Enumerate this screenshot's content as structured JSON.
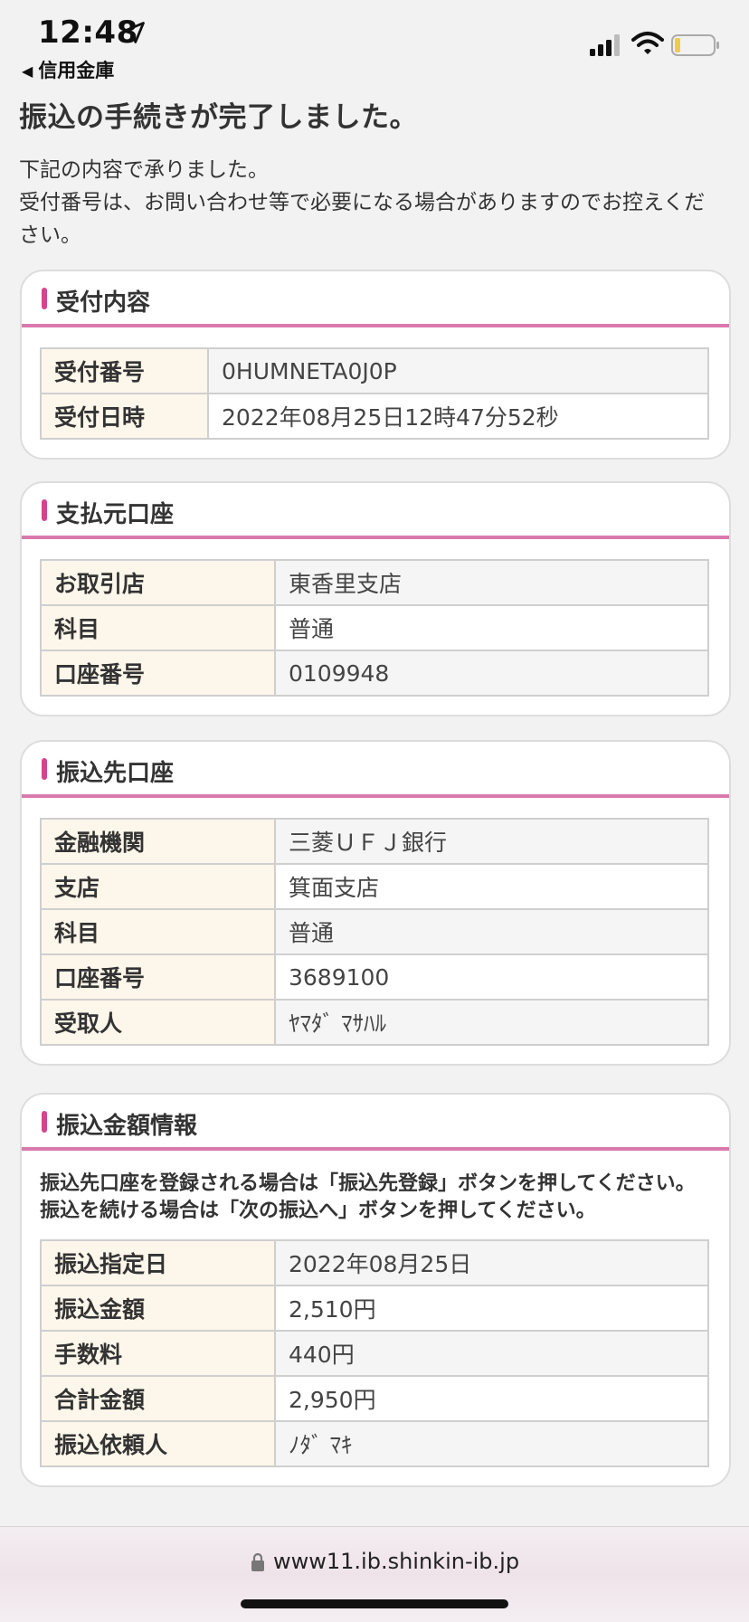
{
  "status_bar": {
    "time": "12:48",
    "back_label": "信用金庫"
  },
  "page": {
    "heading": "振込の手続きが完了しました。",
    "intro": "下記の内容で承りました。\n受付番号は、お問い合わせ等で必要になる場合がありますのでお控えください。"
  },
  "reception": {
    "title": "受付内容",
    "rows": [
      {
        "label": "受付番号",
        "value": "0HUMNETA0J0P"
      },
      {
        "label": "受付日時",
        "value": "2022年08月25日12時47分52秒"
      }
    ]
  },
  "source_account": {
    "title": "支払元口座",
    "rows": [
      {
        "label": "お取引店",
        "value": "東香里支店"
      },
      {
        "label": "科目",
        "value": "普通"
      },
      {
        "label": "口座番号",
        "value": "0109948"
      }
    ]
  },
  "destination_account": {
    "title": "振込先口座",
    "rows": [
      {
        "label": "金融機関",
        "value": "三菱ＵＦＪ銀行"
      },
      {
        "label": "支店",
        "value": "箕面支店"
      },
      {
        "label": "科目",
        "value": "普通"
      },
      {
        "label": "口座番号",
        "value": "3689100"
      },
      {
        "label": "受取人",
        "value": "ﾔﾏﾀﾞ ﾏｻﾊﾙ"
      }
    ]
  },
  "amount_info": {
    "title": "振込金額情報",
    "note": "振込先口座を登録される場合は「振込先登録」ボタンを押してください。\n振込を続ける場合は「次の振込へ」ボタンを押してください。",
    "rows": [
      {
        "label": "振込指定日",
        "value": "2022年08月25日"
      },
      {
        "label": "振込金額",
        "value": "2,510円"
      },
      {
        "label": "手数料",
        "value": "440円"
      },
      {
        "label": "合計金額",
        "value": "2,950円"
      },
      {
        "label": "振込依頼人",
        "value": "ﾉﾀﾞ ﾏｷ"
      }
    ]
  },
  "browser": {
    "url": "www11.ib.shinkin-ib.jp"
  },
  "colors": {
    "accent_pink": "#d97aae",
    "marker_pink": "#d6438f",
    "label_bg": "#fdf6ea"
  }
}
